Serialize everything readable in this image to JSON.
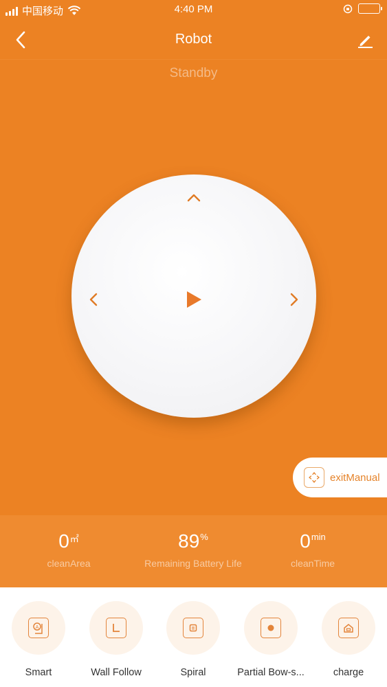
{
  "status_bar": {
    "carrier": "中国移动",
    "time": "4:40 PM"
  },
  "nav": {
    "title": "Robot",
    "back_icon": "chevron-left-icon",
    "edit_icon": "pencil-icon"
  },
  "status": "Standby",
  "joystick": {
    "up_icon": "chevron-up-icon",
    "left_icon": "chevron-left-icon",
    "right_icon": "chevron-right-icon",
    "play_icon": "play-icon"
  },
  "exit_manual": {
    "label": "exitManual",
    "icon": "manual-control-icon"
  },
  "stats": [
    {
      "value": "0",
      "unit": "㎡",
      "label": "cleanArea"
    },
    {
      "value": "89",
      "unit": "%",
      "label": "Remaining Battery Life"
    },
    {
      "value": "0",
      "unit": "min",
      "label": "cleanTime"
    }
  ],
  "modes": [
    {
      "label": "Smart",
      "icon": "smart-mode-icon"
    },
    {
      "label": "Wall Follow",
      "icon": "wall-follow-icon"
    },
    {
      "label": "Spiral",
      "icon": "spiral-icon"
    },
    {
      "label": "Partial Bow-s...",
      "icon": "partial-bow-icon"
    },
    {
      "label": "charge",
      "icon": "charge-home-icon"
    }
  ],
  "colors": {
    "primary": "#ec8223",
    "stats_band": "#ef8b30",
    "accent_text": "#e5832a",
    "mode_bg": "#fdf3e9"
  }
}
